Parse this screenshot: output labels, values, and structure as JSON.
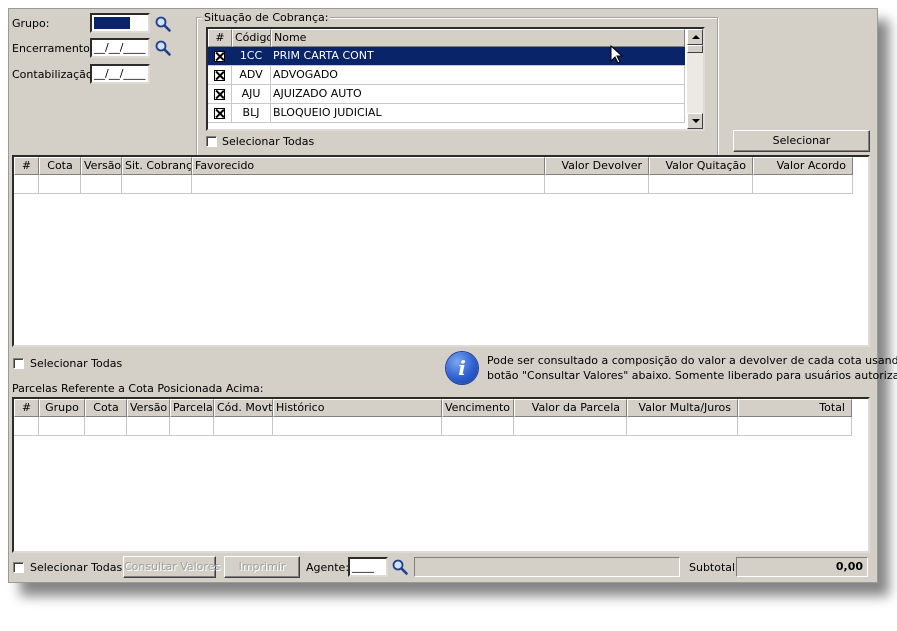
{
  "filters": {
    "grupo_label": "Grupo:",
    "encerramento_label": "Encerramento:",
    "encerramento_value": "__/__/____",
    "contabilizacao_label": "Contabilização:",
    "contabilizacao_value": "__/__/____"
  },
  "situacao": {
    "title": "Situação de Cobrança:",
    "headers": [
      "#",
      "Código",
      "Nome"
    ],
    "rows": [
      {
        "checked": true,
        "codigo": "1CC",
        "nome": "PRIM CARTA CONT",
        "selected": true
      },
      {
        "checked": true,
        "codigo": "ADV",
        "nome": "ADVOGADO",
        "selected": false
      },
      {
        "checked": true,
        "codigo": "AJU",
        "nome": "AJUIZADO AUTO",
        "selected": false
      },
      {
        "checked": true,
        "codigo": "BLJ",
        "nome": "BLOQUEIO JUDICIAL",
        "selected": false
      }
    ],
    "select_all_label": "Selecionar Todas"
  },
  "select_button_label": "Selecionar",
  "cotas_grid": {
    "headers": [
      "#",
      "Cota",
      "Versão",
      "Sit. Cobrança",
      "Favorecido",
      "Valor Devolver",
      "Valor Quitação",
      "Valor Acordo"
    ]
  },
  "cotas_select_all_label": "Selecionar Todas",
  "info_message_line1": "Pode ser consultado a composição do valor a devolver de cada cota usando o",
  "info_message_line2": "botão \"Consultar Valores\" abaixo. Somente liberado para usuários autorizados.",
  "parcelas_label": "Parcelas Referente a Cota Posicionada Acima:",
  "parcelas_grid": {
    "headers": [
      "#",
      "Grupo",
      "Cota",
      "Versão",
      "Parcela",
      "Cód. Movto.",
      "Histórico",
      "Vencimento",
      "Valor da Parcela",
      "Valor Multa/Juros",
      "Total"
    ]
  },
  "footer": {
    "select_all_label": "Selecionar Todas",
    "consultar_label": "Consultar Valores",
    "imprimir_label": "Imprimir",
    "agente_label": "Agente:",
    "agente_value": "____",
    "subtotal_label": "Subtotal:",
    "subtotal_value": "0,00"
  }
}
